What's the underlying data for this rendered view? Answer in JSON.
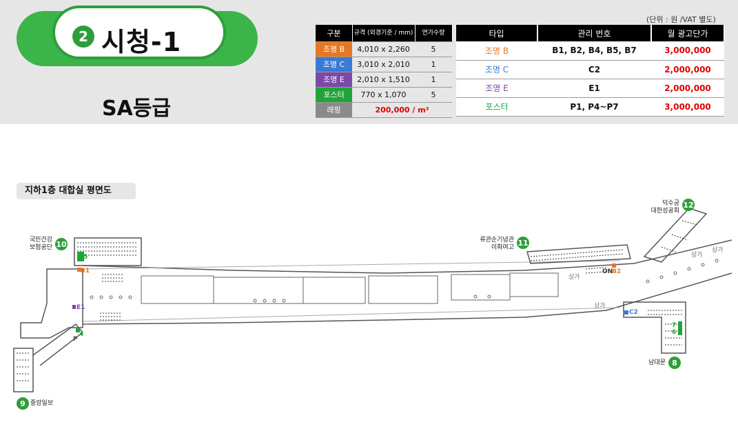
{
  "header": {
    "station_number": "2",
    "station_name": "시청-1",
    "grade": "SA등급",
    "unit_note": "(단위 : 원 /VAT 별도)"
  },
  "spec_table": {
    "headers": [
      "구분",
      "규격 (외경기준 / mm)",
      "연가수량"
    ],
    "rows": [
      {
        "type": "조명 B",
        "size": "4,010 x 2,260",
        "qty": "5"
      },
      {
        "type": "조명 C",
        "size": "3,010 x 2,010",
        "qty": "1"
      },
      {
        "type": "조명 E",
        "size": "2,010 x 1,510",
        "qty": "1"
      },
      {
        "type": "포스터",
        "size": "770 x 1,070",
        "qty": "5"
      }
    ],
    "wrap_label": "래핑",
    "wrap_price": "200,000 / m²"
  },
  "price_table": {
    "headers": [
      "타입",
      "관리 번호",
      "월 광고단가"
    ],
    "rows": [
      {
        "type": "조명 B",
        "codes": "B1, B2, B4, B5, B7",
        "price": "3,000,000"
      },
      {
        "type": "조명 C",
        "codes": "C2",
        "price": "2,000,000"
      },
      {
        "type": "조명 E",
        "codes": "E1",
        "price": "2,000,000"
      },
      {
        "type": "포스터",
        "codes": "P1, P4~P7",
        "price": "3,000,000"
      }
    ]
  },
  "map": {
    "floor_label": "지하1층 대합실 평면도",
    "exits": [
      {
        "num": "10",
        "name": "국민건강\n보험공단"
      },
      {
        "num": "11",
        "name": "류관순기념관\n이화여고"
      },
      {
        "num": "12",
        "name": "덕수궁\n대한성공회"
      },
      {
        "num": "9",
        "name": "중앙일보"
      },
      {
        "num": "8",
        "name": "남대문"
      }
    ],
    "ad_tags": [
      "B1",
      "E1",
      "B2",
      "C2",
      "1",
      "5",
      "4",
      "P",
      "7",
      "6"
    ],
    "shop_labels": [
      "상가",
      "상가",
      "상가",
      "상가",
      "ON"
    ]
  }
}
